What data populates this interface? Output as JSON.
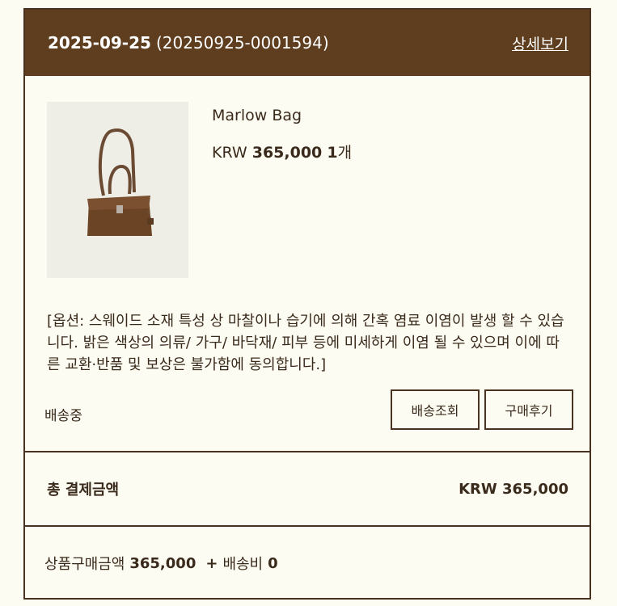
{
  "order": {
    "date": "2025-09-25",
    "order_number": "(20250925-0001594)",
    "detail_link": "상세보기"
  },
  "product": {
    "name": "Marlow Bag",
    "currency": "KRW",
    "price": "365,000",
    "quantity": "1",
    "quantity_unit": "개",
    "image_icon": "bag-product-image",
    "option_note": "[옵션: 스웨이드 소재 특성 상 마찰이나 습기에 의해 간혹 염료 이염이 발생 할 수 있습니다. 밝은 색상의 의류/ 가구/ 바닥재/ 피부 등에 미세하게 이염 될 수 있으며 이에 따른 교환·반품 및 보상은 불가함에 동의합니다.]"
  },
  "status": {
    "label": "배송중",
    "track_button": "배송조회",
    "review_button": "구매후기"
  },
  "total": {
    "label": "총 결제금액",
    "amount": "KRW 365,000"
  },
  "summary": {
    "goods_label": "상품구매금액",
    "goods_amount": "365,000",
    "plus": "+",
    "shipping_label": "배송비",
    "shipping_amount": "0"
  },
  "colors": {
    "header_bg": "#5e3e1f",
    "border": "#4a3220",
    "page_bg": "#fdfcf2"
  }
}
